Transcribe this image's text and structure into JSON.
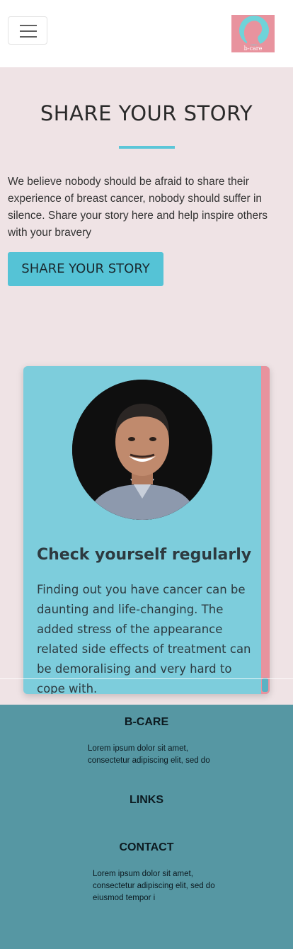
{
  "header": {
    "menu_icon": "hamburger-menu-icon",
    "logo_text": "b-care"
  },
  "hero": {
    "title": "SHARE YOUR STORY",
    "intro": "We believe nobody should be afraid to share their experience of breast cancer, nobody should suffer in silence. Share your story here and help inspire others with your bravery",
    "button_label": "SHARE YOUR STORY"
  },
  "story": {
    "title": "Check yourself regularly",
    "text": "Finding out you have cancer can be daunting and life-changing. The added stress of the appearance related side effects of treatment can be demoralising and very hard to cope with."
  },
  "footer": {
    "brand": "B-CARE",
    "about": "Lorem ipsum dolor sit amet, consectetur adipiscing elit, sed do",
    "links_heading": "LINKS",
    "contact_heading": "CONTACT",
    "contact_text": "Lorem ipsum dolor sit amet, consectetur adipiscing elit, sed do eiusmod tempor i"
  },
  "colors": {
    "accent": "#55c3d6",
    "card": "#7dcddc",
    "pink": "#e8939e",
    "footer": "#5697a3",
    "page_bg": "#efe3e5"
  }
}
